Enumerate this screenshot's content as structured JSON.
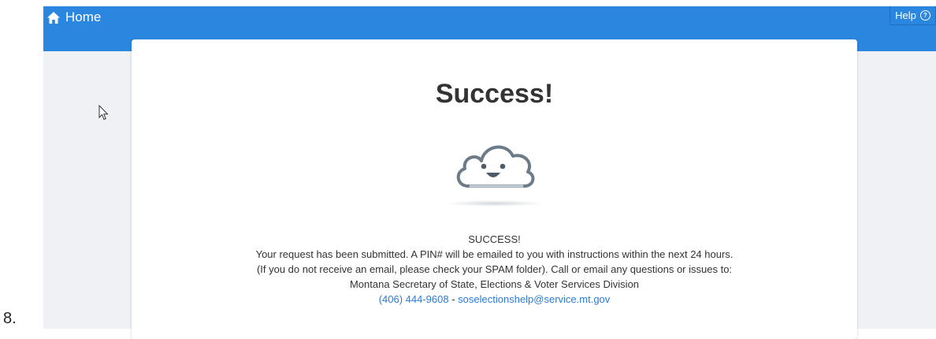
{
  "header": {
    "home_label": "Home",
    "help_label": "Help"
  },
  "main": {
    "title": "Success!",
    "status": "SUCCESS!",
    "line1": "Your request has been submitted. A PIN# will be emailed to you with instructions within the next 24 hours.",
    "line2": "(If you do not receive an email, please check your SPAM folder). Call or email any questions or issues to:",
    "org": "Montana Secretary of State, Elections & Voter Services Division",
    "phone": "(406) 444-9608",
    "separator": " - ",
    "email": "soselectionshelp@service.mt.gov"
  },
  "prefix_label": "8.",
  "colors": {
    "header_bg": "#2b86e0",
    "page_bg": "#eff1f4",
    "link": "#2b7bd6",
    "cloud_stroke": "#6c7b88"
  },
  "icons": {
    "home": "home-icon",
    "help": "question-circle-icon",
    "illustration": "smiling-cloud-icon",
    "cursor": "mouse-pointer-icon"
  }
}
